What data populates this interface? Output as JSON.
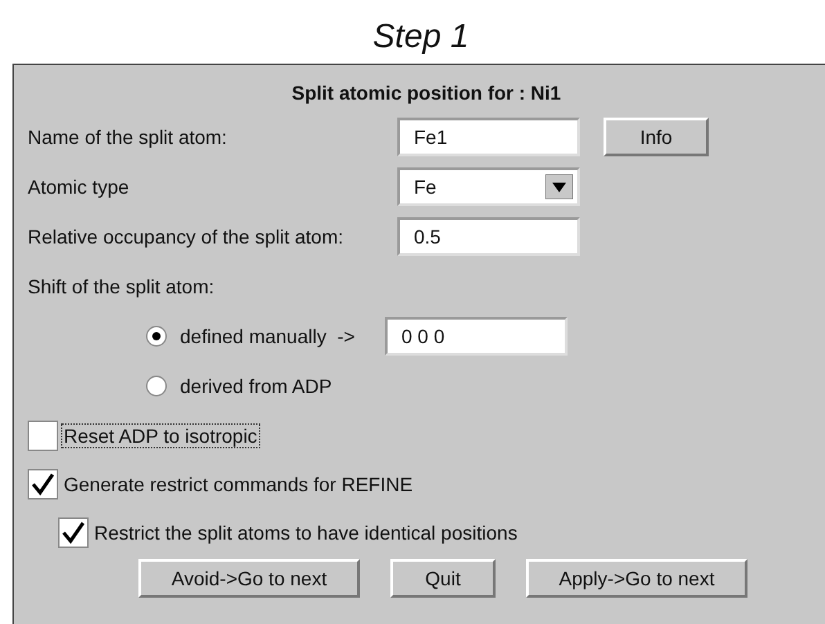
{
  "caption": "Step 1",
  "dialog": {
    "title": "Split atomic position for : Ni1",
    "fields": [
      {
        "kind": "text",
        "label": "Name of the split atom:",
        "value": "Fe1"
      },
      {
        "kind": "dropdown",
        "label": "Atomic type",
        "value": "Fe"
      },
      {
        "kind": "text",
        "label": "Relative occupancy of the split atom:",
        "value": "0.5"
      }
    ],
    "info_button": "Info",
    "shift": {
      "label": "Shift of the split atom:",
      "options": [
        {
          "label": "defined manually  ->",
          "selected": true,
          "value": "0 0 0"
        },
        {
          "label": "derived from ADP",
          "selected": false
        }
      ]
    },
    "checkboxes": [
      {
        "label": "Reset ADP to isotropic",
        "checked": false,
        "focused": true
      },
      {
        "label": "Generate restrict commands for REFINE",
        "checked": true,
        "focused": false,
        "children": [
          {
            "label": "Restrict the split atoms to have identical positions",
            "checked": true,
            "focused": false
          }
        ]
      }
    ],
    "buttons": [
      "Avoid->Go to next",
      "Quit",
      "Apply->Go to next"
    ]
  }
}
